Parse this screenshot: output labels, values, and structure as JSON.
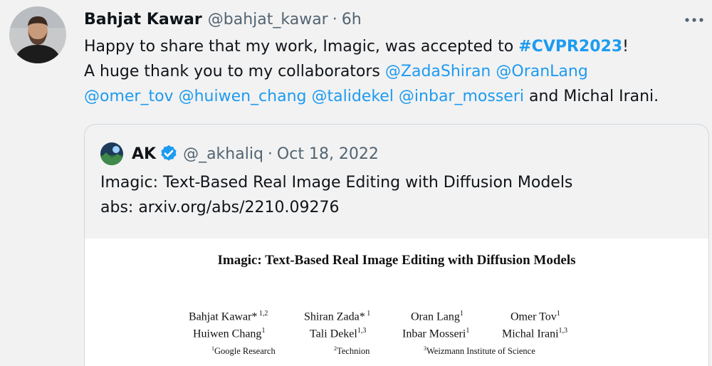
{
  "tweet": {
    "author_name": "Bahjat Kawar",
    "handle": "@bahjat_kawar",
    "separator": "·",
    "time": "6h",
    "line1_text": "Happy to share that my work, Imagic, was accepted to ",
    "hashtag": "#CVPR2023",
    "line1_end": "!",
    "line2_text": "A huge thank you to my collaborators ",
    "mentions": [
      "@ZadaShiran",
      "@OranLang",
      "@omer_tov",
      "@huiwen_chang",
      "@talidekel",
      "@inbar_mosseri"
    ],
    "line3_end": " and Michal Irani."
  },
  "quoted": {
    "author_name": "AK",
    "handle": "@_akhaliq",
    "separator": "·",
    "date": "Oct 18, 2022",
    "text_line1": "Imagic: Text-Based Real Image Editing with Diffusion Models",
    "text_line2": "abs: arxiv.org/abs/2210.09276"
  },
  "paper": {
    "title": "Imagic: Text-Based Real Image Editing with Diffusion Models",
    "authors": [
      {
        "name": "Bahjat Kawar*",
        "sup": " 1,2"
      },
      {
        "name": "Shiran Zada*",
        "sup": " 1"
      },
      {
        "name": "Oran Lang",
        "sup": "1"
      },
      {
        "name": "Omer Tov",
        "sup": "1"
      },
      {
        "name": "Huiwen Chang",
        "sup": "1"
      },
      {
        "name": "Tali Dekel",
        "sup": "1,3"
      },
      {
        "name": "Inbar Mosseri",
        "sup": "1"
      },
      {
        "name": "Michal Irani",
        "sup": "1,3"
      }
    ],
    "affiliations": [
      {
        "sup": "1",
        "name": "Google Research"
      },
      {
        "sup": "2",
        "name": "Technion"
      },
      {
        "sup": "3",
        "name": "Weizmann Institute of Science"
      }
    ]
  },
  "colors": {
    "link": "#1d9bf0",
    "muted": "#536471",
    "verified": "#1d9bf0",
    "border": "#cfd9de"
  },
  "icons": {
    "more": "more-icon",
    "verified": "verified-badge-icon"
  }
}
